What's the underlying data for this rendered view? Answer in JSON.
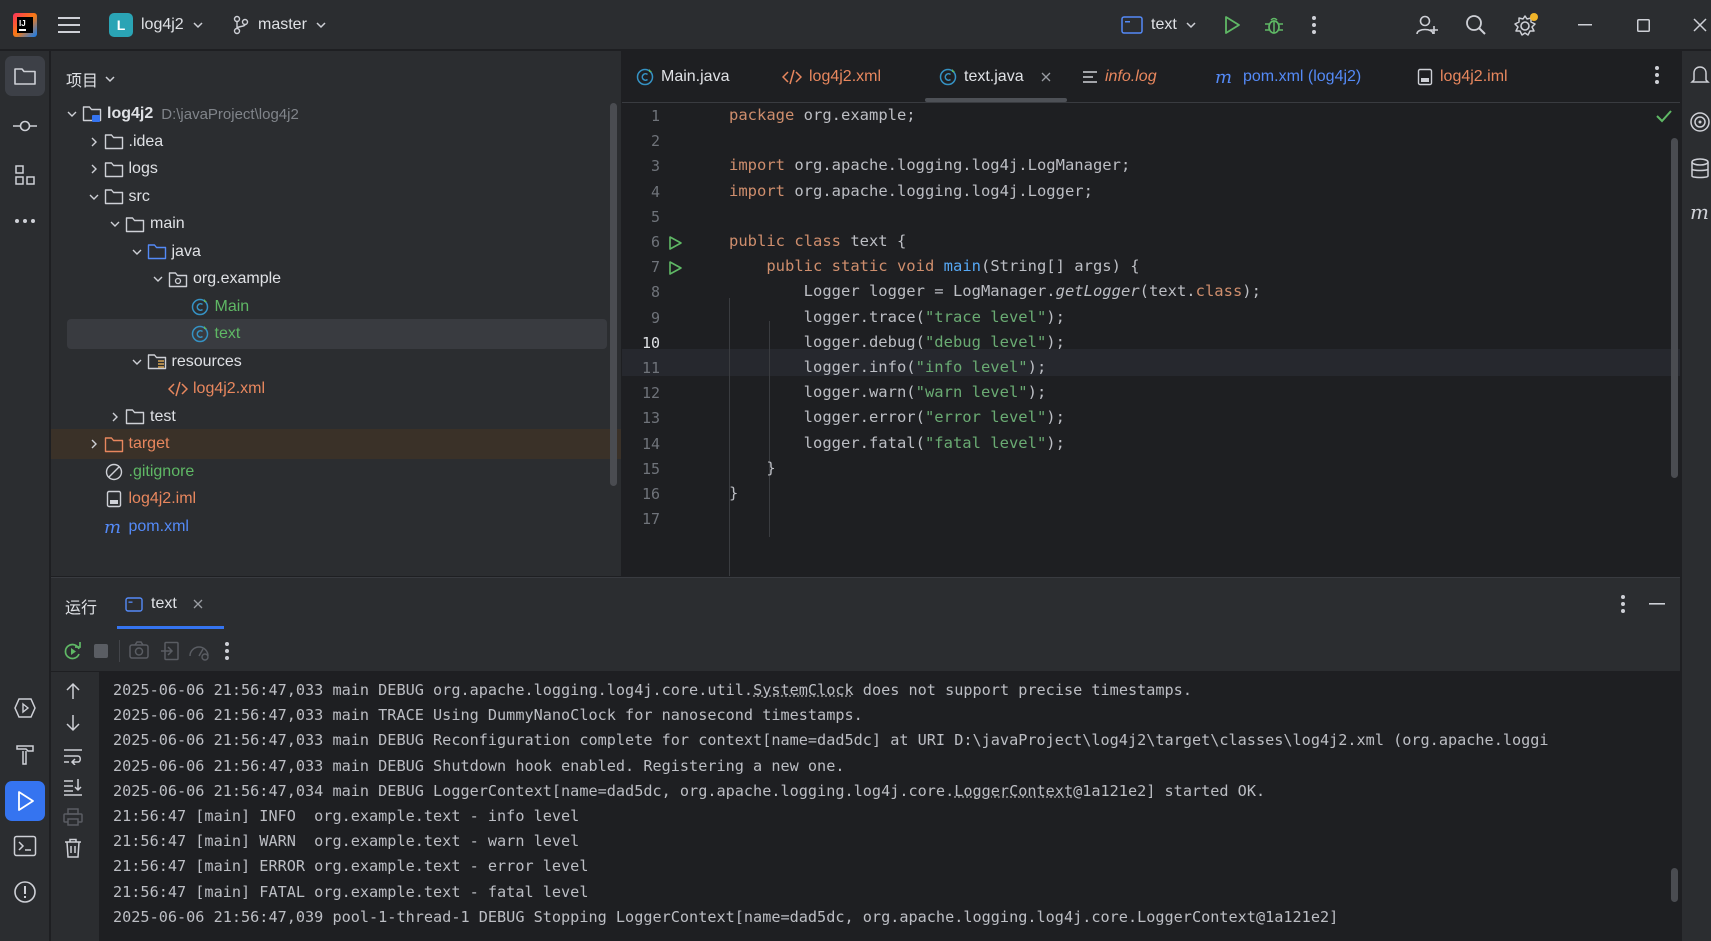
{
  "titlebar": {
    "project_initial": "L",
    "project_name": "log4j2",
    "branch": "master",
    "run_config": "text",
    "icons": [
      "intellij-logo-icon",
      "hamburger-menu-icon",
      "branch-icon",
      "run-icon",
      "debug-icon",
      "more-vert-icon",
      "add-user-icon",
      "search-icon",
      "settings-icon",
      "minimize-icon",
      "maximize-icon",
      "close-icon"
    ]
  },
  "project_panel": {
    "title": "项目",
    "tree": [
      {
        "label": "log4j2",
        "hint": "D:\\javaProject\\log4j2",
        "kind": "module",
        "depth": 0,
        "expanded": true
      },
      {
        "label": ".idea",
        "kind": "folder",
        "depth": 1,
        "expanded": false
      },
      {
        "label": "logs",
        "kind": "folder",
        "depth": 1,
        "expanded": false
      },
      {
        "label": "src",
        "kind": "folder",
        "depth": 1,
        "expanded": true
      },
      {
        "label": "main",
        "kind": "folder",
        "depth": 2,
        "expanded": true
      },
      {
        "label": "java",
        "kind": "source-folder",
        "depth": 3,
        "expanded": true
      },
      {
        "label": "org.example",
        "kind": "package",
        "depth": 4,
        "expanded": true
      },
      {
        "label": "Main",
        "kind": "class",
        "depth": 5
      },
      {
        "label": "text",
        "kind": "class",
        "depth": 5,
        "selected": true
      },
      {
        "label": "resources",
        "kind": "resources-folder",
        "depth": 3,
        "expanded": true
      },
      {
        "label": "log4j2.xml",
        "kind": "xml",
        "depth": 4
      },
      {
        "label": "test",
        "kind": "folder",
        "depth": 2,
        "expanded": false
      },
      {
        "label": "target",
        "kind": "excluded-folder",
        "depth": 1,
        "expanded": false
      },
      {
        "label": ".gitignore",
        "kind": "ignore",
        "depth": 1
      },
      {
        "label": "log4j2.iml",
        "kind": "iml",
        "depth": 1
      },
      {
        "label": "pom.xml",
        "kind": "maven",
        "depth": 1
      }
    ]
  },
  "editor": {
    "tabs": [
      {
        "label": "Main.java",
        "icon": "java-class-icon"
      },
      {
        "label": "log4j2.xml",
        "icon": "xml-icon"
      },
      {
        "label": "text.java",
        "icon": "java-class-icon",
        "active": true
      },
      {
        "label": "info.log",
        "icon": "log-icon"
      },
      {
        "label": "pom.xml (log4j2)",
        "icon": "maven-icon"
      },
      {
        "label": "log4j2.iml",
        "icon": "iml-icon"
      }
    ],
    "current_line": 10,
    "line_numbers": [
      "1",
      "2",
      "3",
      "4",
      "5",
      "6",
      "7",
      "8",
      "9",
      "10",
      "11",
      "12",
      "13",
      "14",
      "15",
      "16",
      "17"
    ],
    "lines": [
      {
        "parts": [
          {
            "t": "package",
            "c": "kw"
          },
          {
            "t": " org.example;",
            "c": ""
          }
        ]
      },
      {
        "parts": []
      },
      {
        "parts": [
          {
            "t": "import",
            "c": "kw"
          },
          {
            "t": " org.apache.logging.log4j.LogManager;",
            "c": ""
          }
        ]
      },
      {
        "parts": [
          {
            "t": "import",
            "c": "kw"
          },
          {
            "t": " org.apache.logging.log4j.Logger;",
            "c": ""
          }
        ]
      },
      {
        "parts": []
      },
      {
        "parts": [
          {
            "t": "public class",
            "c": "kw"
          },
          {
            "t": " text {",
            "c": ""
          }
        ]
      },
      {
        "parts": [
          {
            "t": "    ",
            "c": ""
          },
          {
            "t": "public static void",
            "c": "kw"
          },
          {
            "t": " ",
            "c": ""
          },
          {
            "t": "main",
            "c": "fn"
          },
          {
            "t": "(String[] args) {",
            "c": ""
          }
        ]
      },
      {
        "parts": [
          {
            "t": "        Logger logger = LogManager.",
            "c": ""
          },
          {
            "t": "getLogger",
            "c": "it"
          },
          {
            "t": "(text.",
            "c": ""
          },
          {
            "t": "class",
            "c": "kw"
          },
          {
            "t": ");",
            "c": ""
          }
        ]
      },
      {
        "parts": [
          {
            "t": "        logger.trace(",
            "c": ""
          },
          {
            "t": "\"trace level\"",
            "c": "str"
          },
          {
            "t": ");",
            "c": ""
          }
        ]
      },
      {
        "parts": [
          {
            "t": "        logger.debug(",
            "c": ""
          },
          {
            "t": "\"debug level\"",
            "c": "str"
          },
          {
            "t": ");",
            "c": ""
          }
        ]
      },
      {
        "parts": [
          {
            "t": "        logger.info(",
            "c": ""
          },
          {
            "t": "\"info level\"",
            "c": "str"
          },
          {
            "t": ");",
            "c": ""
          }
        ]
      },
      {
        "parts": [
          {
            "t": "        logger.warn(",
            "c": ""
          },
          {
            "t": "\"warn level\"",
            "c": "str"
          },
          {
            "t": ");",
            "c": ""
          }
        ]
      },
      {
        "parts": [
          {
            "t": "        logger.error(",
            "c": ""
          },
          {
            "t": "\"error level\"",
            "c": "str"
          },
          {
            "t": ");",
            "c": ""
          }
        ]
      },
      {
        "parts": [
          {
            "t": "        logger.fatal(",
            "c": ""
          },
          {
            "t": "\"fatal level\"",
            "c": "str"
          },
          {
            "t": ");",
            "c": ""
          }
        ]
      },
      {
        "parts": [
          {
            "t": "    }",
            "c": ""
          }
        ]
      },
      {
        "parts": [
          {
            "t": "}",
            "c": ""
          }
        ]
      },
      {
        "parts": []
      }
    ]
  },
  "run_panel": {
    "title": "运行",
    "tab_label": "text",
    "console": [
      [
        {
          "t": "2025-06-06 21:56:47,033 main DEBUG org.apache.logging.log4j.core.util.",
          "u": false
        },
        {
          "t": "SystemClock",
          "u": true
        },
        {
          "t": " does not support precise timestamps.",
          "u": false
        }
      ],
      [
        {
          "t": "2025-06-06 21:56:47,033 main TRACE Using DummyNanoClock for nanosecond timestamps.",
          "u": false
        }
      ],
      [
        {
          "t": "2025-06-06 21:56:47,033 main DEBUG Reconfiguration complete for context[name=dad5dc] at URI D:\\javaProject\\log4j2\\target\\classes\\log4j2.xml (org.apache.loggi",
          "u": false
        }
      ],
      [
        {
          "t": "2025-06-06 21:56:47,033 main DEBUG Shutdown hook enabled. Registering a new one.",
          "u": false
        }
      ],
      [
        {
          "t": "2025-06-06 21:56:47,034 main DEBUG LoggerContext[name=dad5dc, org.apache.logging.log4j.core.",
          "u": false
        },
        {
          "t": "LoggerContext",
          "u": true
        },
        {
          "t": "@1a121e2] started OK.",
          "u": false
        }
      ],
      [
        {
          "t": "21:56:47 [main] INFO  org.example.text - info level",
          "u": false
        }
      ],
      [
        {
          "t": "21:56:47 [main] WARN  org.example.text - warn level",
          "u": false
        }
      ],
      [
        {
          "t": "21:56:47 [main] ERROR org.example.text - error level",
          "u": false
        }
      ],
      [
        {
          "t": "21:56:47 [main] FATAL org.example.text - fatal level",
          "u": false
        }
      ],
      [
        {
          "t": "2025-06-06 21:56:47,039 pool-1-thread-1 DEBUG Stopping LoggerContext[name=dad5dc, org.apache.logging.log4j.core.LoggerContext@1a121e2]",
          "u": false
        }
      ]
    ]
  },
  "colors": {
    "accent": "#3574f0",
    "keyword": "#cf8e6d",
    "string": "#6aab73",
    "function": "#56a8f5",
    "class_icon": "#3592c4",
    "xml": "#e8875e",
    "run_green": "#5fb865"
  }
}
